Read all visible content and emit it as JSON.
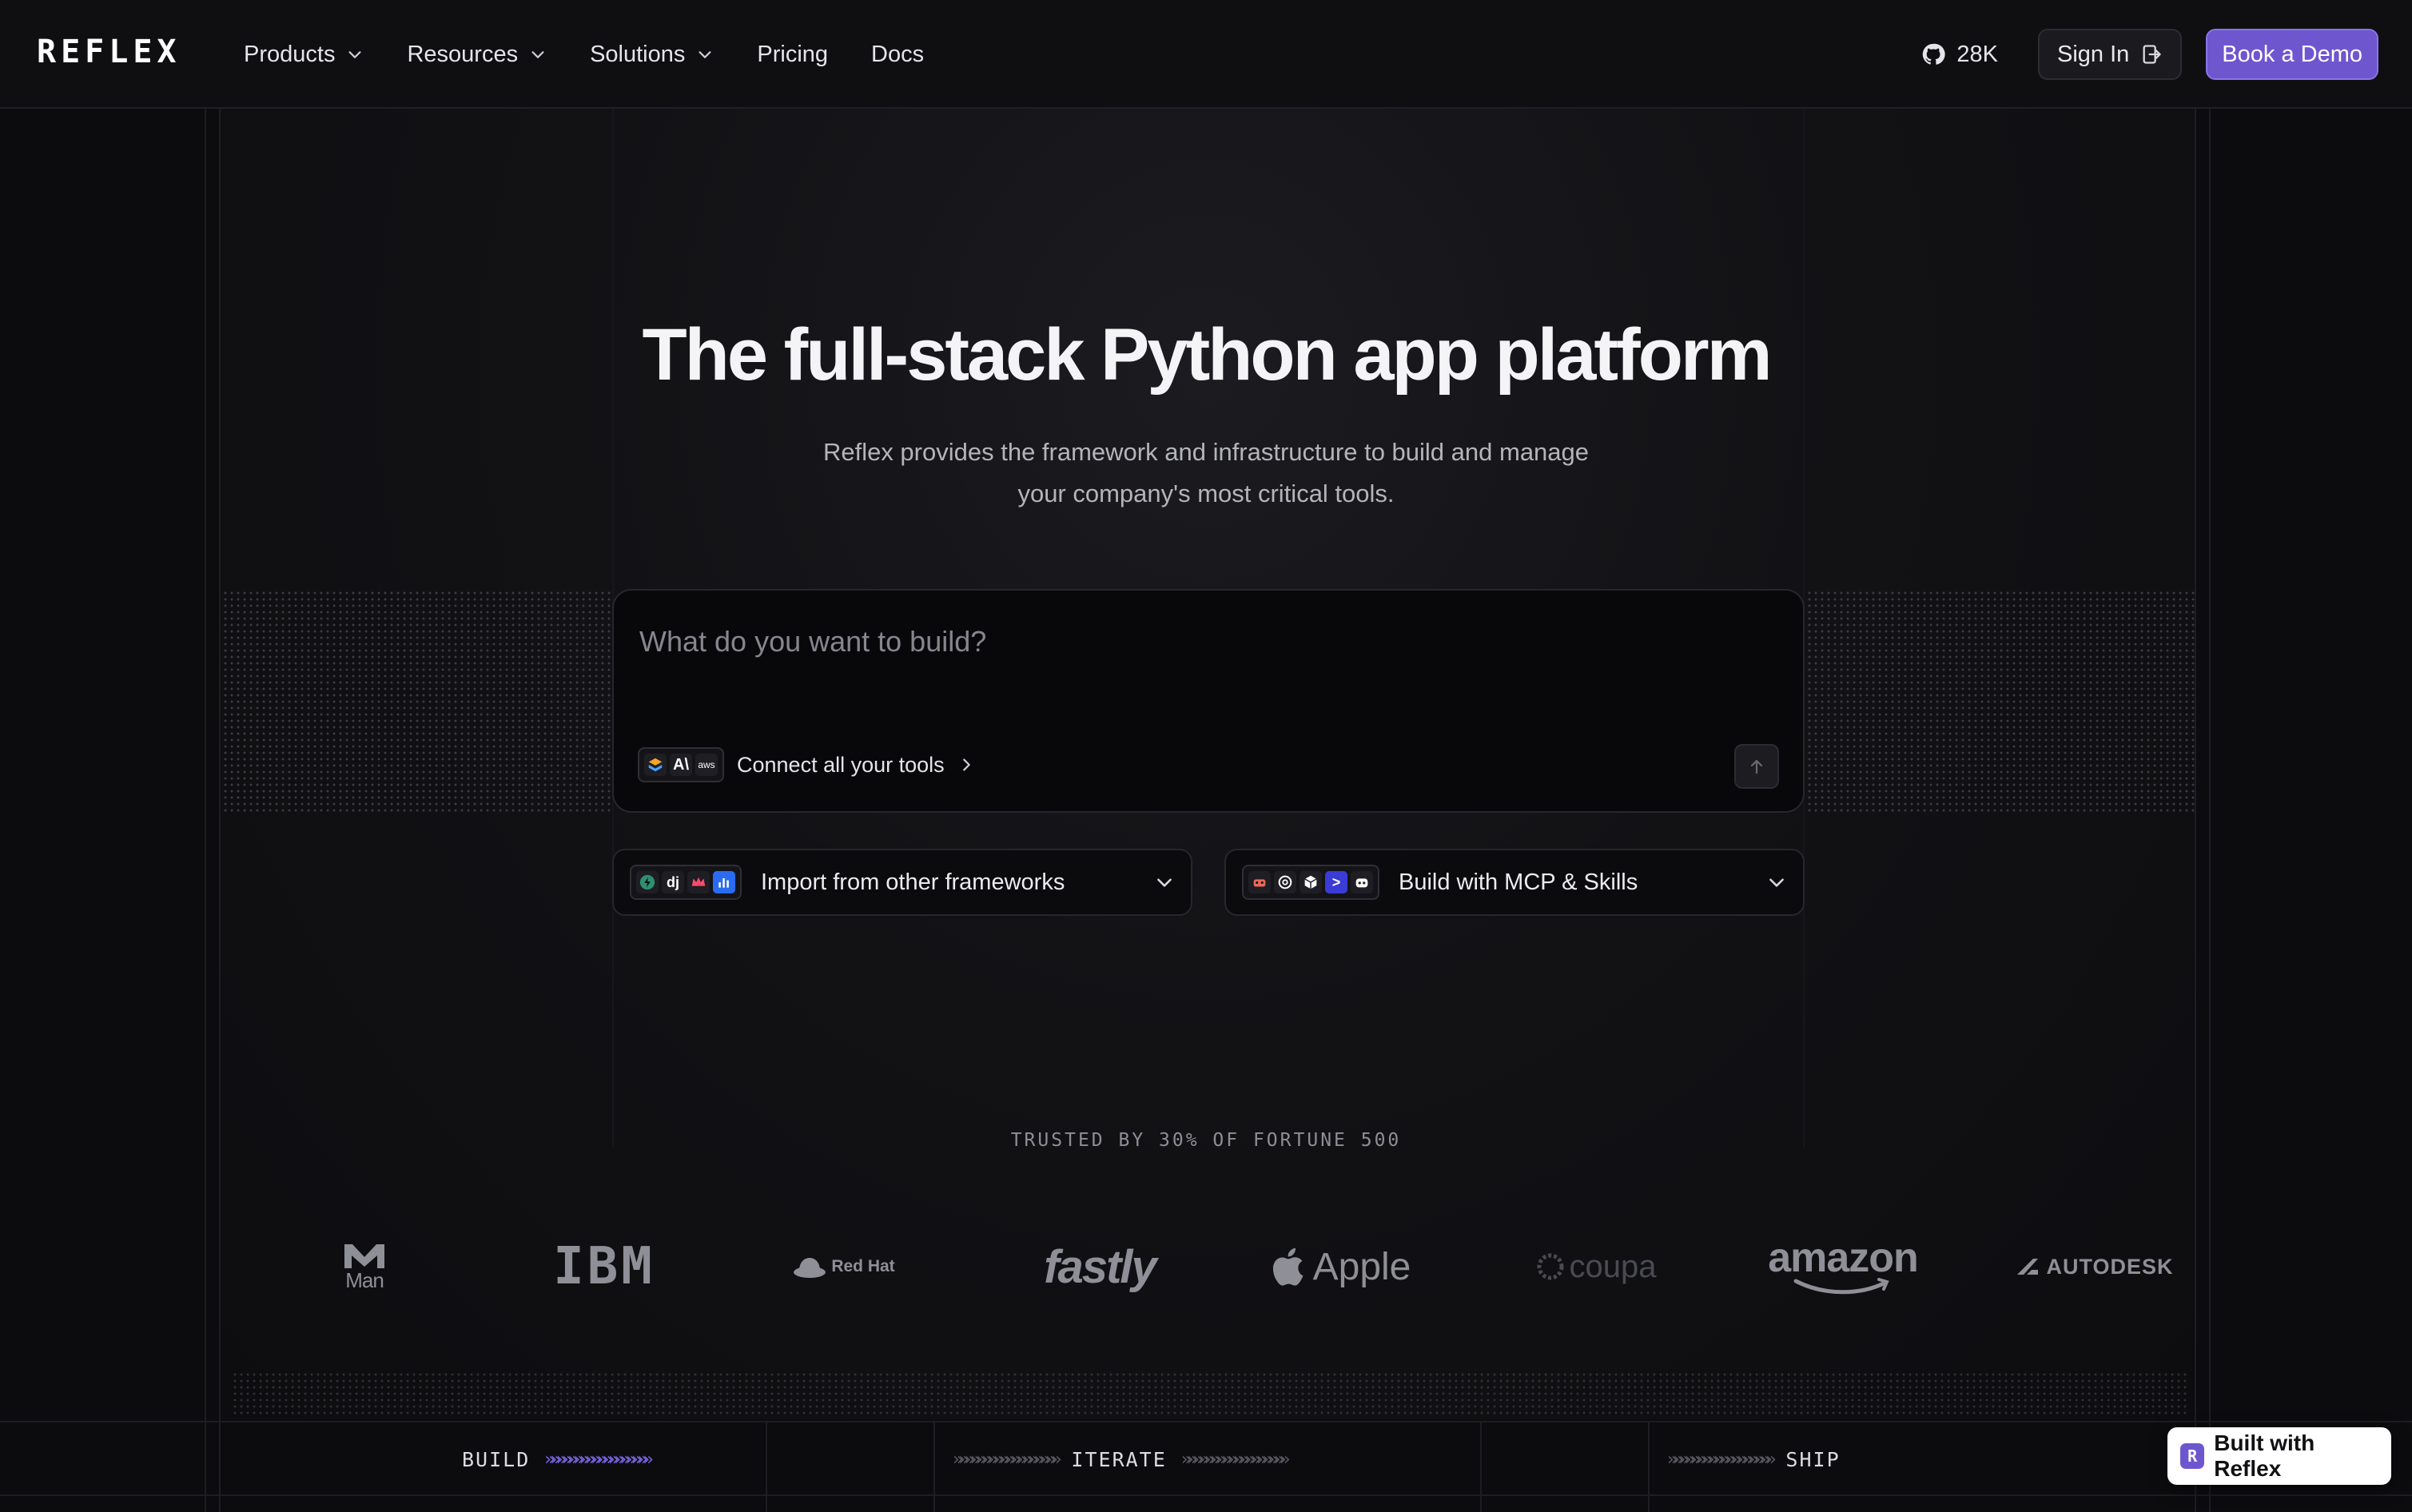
{
  "nav": {
    "logo": "REFLEX",
    "menu": [
      {
        "label": "Products",
        "has_dropdown": true
      },
      {
        "label": "Resources",
        "has_dropdown": true
      },
      {
        "label": "Solutions",
        "has_dropdown": true
      },
      {
        "label": "Pricing",
        "has_dropdown": false
      },
      {
        "label": "Docs",
        "has_dropdown": false
      }
    ],
    "github_stars": "28K",
    "sign_in_label": "Sign In",
    "book_demo_label": "Book a Demo"
  },
  "hero": {
    "title": "The full-stack Python app platform",
    "subtitle_line1": "Reflex provides the framework and infrastructure to build and manage",
    "subtitle_line2": "your company's most critical tools."
  },
  "prompt": {
    "placeholder": "What do you want to build?",
    "value": "",
    "connect_label": "Connect all your tools",
    "tool_icons": [
      "box-stack-icon",
      "anthropic-icon",
      "aws-icon"
    ]
  },
  "dropdowns": {
    "import_label": "Import from other frameworks",
    "import_icons": [
      "streamlit-icon",
      "django-icon",
      "crown-icon",
      "chart-icon"
    ],
    "mcp_label": "Build with MCP & Skills",
    "mcp_icons": [
      "bug-icon",
      "openai-icon",
      "cube-icon",
      "terminal-icon",
      "robot-icon"
    ]
  },
  "trusted": {
    "label": "TRUSTED BY 30% OF FORTUNE 500",
    "logos": [
      "Man",
      "IBM",
      "Red Hat",
      "fastly",
      "Apple",
      "coupa",
      "amazon",
      "AUTODESK"
    ]
  },
  "steps": {
    "build": "BUILD",
    "iterate": "ITERATE",
    "ship": "SHIP",
    "arrow_glyphs": "»»»»»»»»»»»»»»»»»»"
  },
  "badge": {
    "mark": "R",
    "label": "Built with Reflex"
  },
  "colors": {
    "background": "#0c0c0f",
    "accent": "#6e56cf",
    "text": "#e8e8ec",
    "muted": "#8e8e97"
  }
}
